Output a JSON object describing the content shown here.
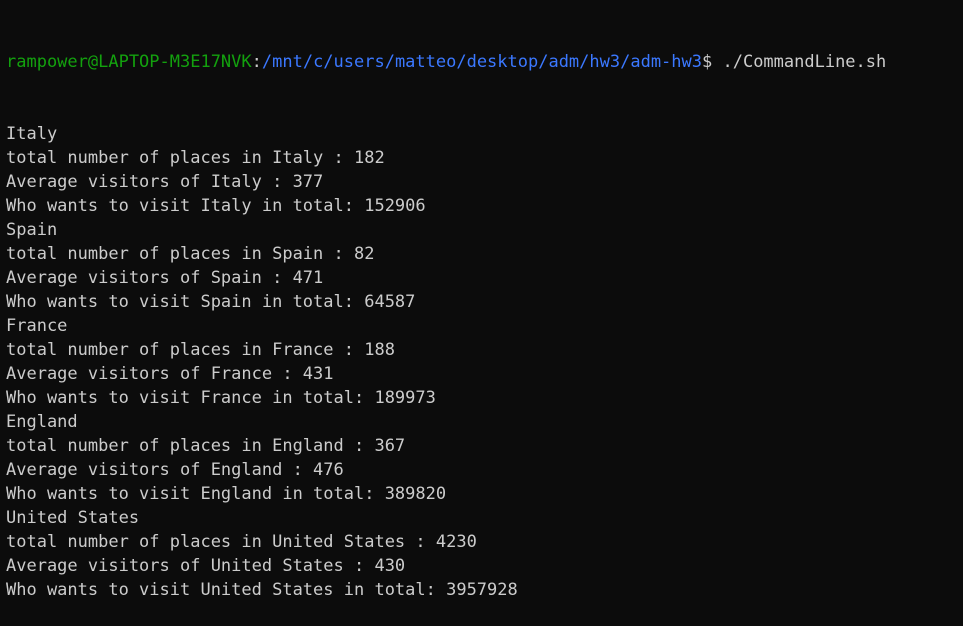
{
  "prompt": {
    "user_host": "rampower@LAPTOP-M3E17NVK",
    "separator": ":",
    "path": "/mnt/c/users/matteo/desktop/adm/hw3/adm-hw3",
    "symbol": "$",
    "command": " ./CommandLine.sh"
  },
  "output_lines": [
    "Italy",
    "total number of places in Italy : 182",
    "Average visitors of Italy : 377",
    "Who wants to visit Italy in total: 152906",
    "Spain",
    "total number of places in Spain : 82",
    "Average visitors of Spain : 471",
    "Who wants to visit Spain in total: 64587",
    "France",
    "total number of places in France : 188",
    "Average visitors of France : 431",
    "Who wants to visit France in total: 189973",
    "England",
    "total number of places in England : 367",
    "Average visitors of England : 476",
    "Who wants to visit England in total: 389820",
    "United States",
    "total number of places in United States : 4230",
    "Average visitors of United States : 430",
    "Who wants to visit United States in total: 3957928"
  ],
  "colors": {
    "background": "#0c0c0c",
    "text": "#cccccc",
    "user_host": "#13a10e",
    "path": "#3b78ff"
  }
}
